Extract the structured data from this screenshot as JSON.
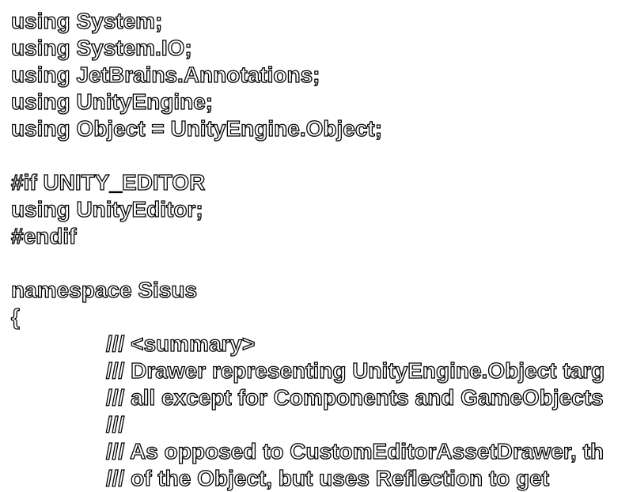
{
  "code": {
    "lines": [
      {
        "text": "using System;",
        "indent": 0
      },
      {
        "text": "using System.IO;",
        "indent": 0
      },
      {
        "text": "using JetBrains.Annotations;",
        "indent": 0
      },
      {
        "text": "using UnityEngine;",
        "indent": 0
      },
      {
        "text": "using Object = UnityEngine.Object;",
        "indent": 0
      },
      {
        "text": "",
        "indent": 0
      },
      {
        "text": "#if UNITY_EDITOR",
        "indent": 0
      },
      {
        "text": "using UnityEditor;",
        "indent": 0
      },
      {
        "text": "#endif",
        "indent": 0
      },
      {
        "text": "",
        "indent": 0
      },
      {
        "text": "namespace Sisus",
        "indent": 0
      },
      {
        "text": "{",
        "indent": 0
      },
      {
        "text": "/// <summary>",
        "indent": 1
      },
      {
        "text": "/// Drawer representing UnityEngine.Object targ",
        "indent": 1
      },
      {
        "text": "/// all except for Components and GameObjects",
        "indent": 1
      },
      {
        "text": "///",
        "indent": 1
      },
      {
        "text": "/// As opposed to CustomEditorAssetDrawer, th",
        "indent": 1
      },
      {
        "text": "/// of the Object, but uses Reflection to get",
        "indent": 1
      }
    ]
  }
}
